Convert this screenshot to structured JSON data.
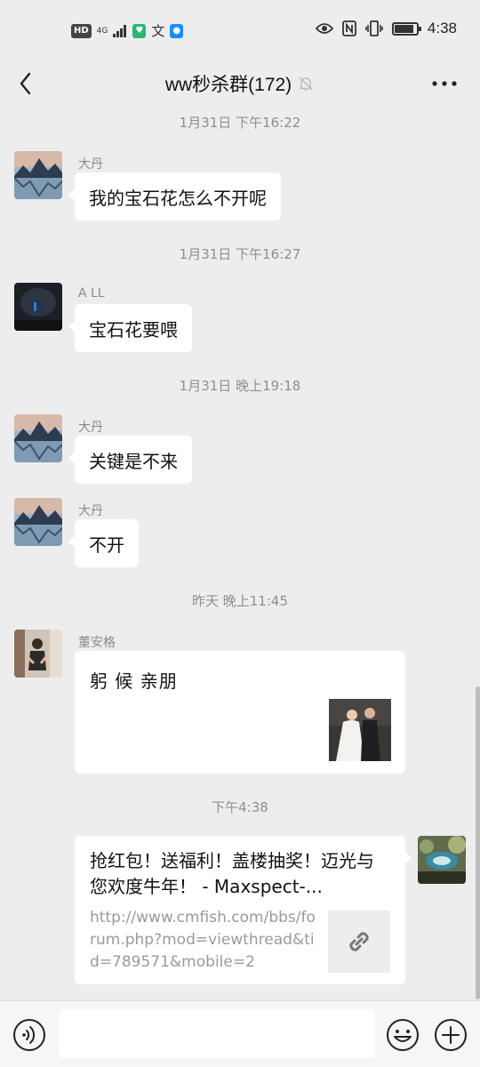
{
  "status_bar": {
    "hd": "HD",
    "net": "4G",
    "time": "4:38"
  },
  "header": {
    "title": "ww秒杀群(172)"
  },
  "messages": [
    {
      "timestamp": "1月31日 下午16:22"
    },
    {
      "sender": "大丹",
      "text": "我的宝石花怎么不开呢"
    },
    {
      "timestamp": "1月31日 下午16:27"
    },
    {
      "sender": "A LL",
      "text": "宝石花要喂"
    },
    {
      "timestamp": "1月31日 晚上19:18"
    },
    {
      "sender": "大丹",
      "text": "关键是不来"
    },
    {
      "sender": "大丹",
      "text": "不开"
    },
    {
      "timestamp": "昨天 晚上11:45"
    },
    {
      "sender": "董安格",
      "text": "躬 候 亲朋"
    },
    {
      "timestamp": "下午4:38"
    },
    {
      "link_title": "抢红包！送福利！盖楼抽奖！迈光与您欢度牛年！ - Maxspect-...",
      "link_url": "http://www.cmfish.com/bbs/forum.php?mod=viewthread&tid=789571&mobile=2"
    }
  ],
  "input": {
    "placeholder": ""
  },
  "colors": {
    "background": "#ededed",
    "bubble": "#ffffff",
    "timestamp": "#8f8f8f"
  }
}
